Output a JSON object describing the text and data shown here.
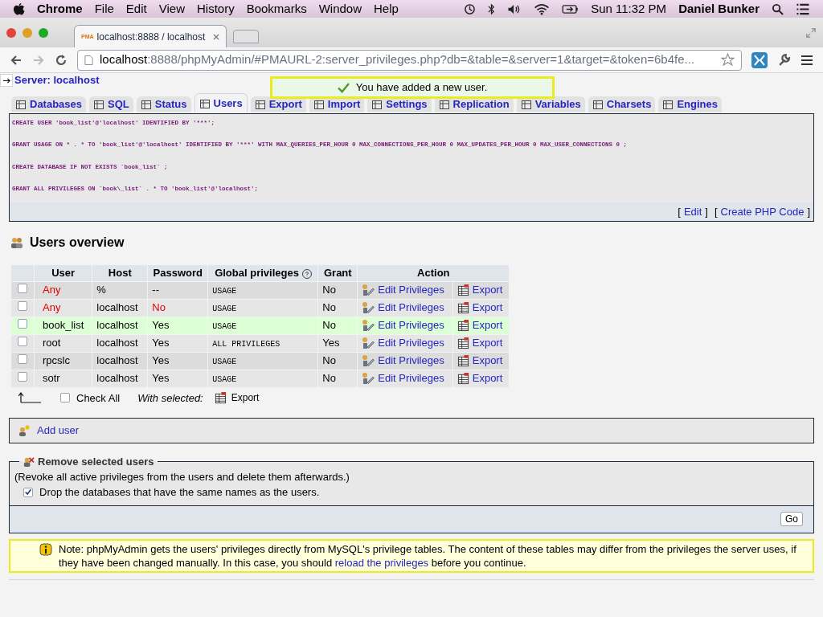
{
  "menubar": {
    "app": "Chrome",
    "menus": [
      "File",
      "Edit",
      "View",
      "History",
      "Bookmarks",
      "Window",
      "Help"
    ],
    "clock": "Sun 11:32 PM",
    "user": "Daniel Bunker"
  },
  "browser": {
    "tab_title": "localhost:8888 / localhost",
    "tab_badge": "PMA",
    "url_host": "localhost",
    "url_rest": ":8888/phpMyAdmin/#PMAURL-2:server_privileges.php?db=&table=&server=1&target=&token=6b4fe..."
  },
  "breadcrumb": "Server: localhost",
  "notification": "You have added a new user.",
  "tabs": [
    {
      "label": "Databases",
      "selected": false
    },
    {
      "label": "SQL",
      "selected": false
    },
    {
      "label": "Status",
      "selected": false
    },
    {
      "label": "Users",
      "selected": true
    },
    {
      "label": "Export",
      "selected": false
    },
    {
      "label": "Import",
      "selected": false
    },
    {
      "label": "Settings",
      "selected": false
    },
    {
      "label": "Replication",
      "selected": false
    },
    {
      "label": "Variables",
      "selected": false
    },
    {
      "label": "Charsets",
      "selected": false
    },
    {
      "label": "Engines",
      "selected": false
    }
  ],
  "sql_lines": [
    "CREATE USER 'book_list'@'localhost' IDENTIFIED BY '***';",
    "GRANT USAGE ON * . * TO 'book_list'@'localhost' IDENTIFIED BY '***' WITH MAX_QUERIES_PER_HOUR 0 MAX_CONNECTIONS_PER_HOUR 0 MAX_UPDATES_PER_HOUR 0 MAX_USER_CONNECTIONS 0 ;",
    "CREATE DATABASE IF NOT EXISTS `book_list` ;",
    "GRANT ALL PRIVILEGES ON `book\\_list` . * TO 'book_list'@'localhost';"
  ],
  "sql_links": [
    {
      "open": "[",
      "label": "Edit",
      "close": "]"
    },
    {
      "open": "[",
      "label": "Create PHP Code",
      "close": "]"
    }
  ],
  "users_overview": {
    "title": "Users overview",
    "columns": [
      "User",
      "Host",
      "Password",
      "Global privileges",
      "Grant",
      "Action"
    ],
    "rows": [
      {
        "user": "Any",
        "user_warn": true,
        "host": "%",
        "password": "--",
        "password_warn": false,
        "privileges": "USAGE",
        "grant": "No",
        "checked": false,
        "highlighted": false,
        "edit": "Edit Privileges",
        "export": "Export"
      },
      {
        "user": "Any",
        "user_warn": true,
        "host": "localhost",
        "password": "No",
        "password_warn": true,
        "privileges": "USAGE",
        "grant": "No",
        "checked": false,
        "highlighted": false,
        "edit": "Edit Privileges",
        "export": "Export"
      },
      {
        "user": "book_list",
        "user_warn": false,
        "host": "localhost",
        "password": "Yes",
        "password_warn": false,
        "privileges": "USAGE",
        "grant": "No",
        "checked": false,
        "highlighted": true,
        "edit": "Edit Privileges",
        "export": "Export"
      },
      {
        "user": "root",
        "user_warn": false,
        "host": "localhost",
        "password": "Yes",
        "password_warn": false,
        "privileges": "ALL PRIVILEGES",
        "grant": "Yes",
        "checked": false,
        "highlighted": false,
        "edit": "Edit Privileges",
        "export": "Export"
      },
      {
        "user": "rpcslc",
        "user_warn": false,
        "host": "localhost",
        "password": "Yes",
        "password_warn": false,
        "privileges": "USAGE",
        "grant": "No",
        "checked": false,
        "highlighted": false,
        "edit": "Edit Privileges",
        "export": "Export"
      },
      {
        "user": "sotr",
        "user_warn": false,
        "host": "localhost",
        "password": "Yes",
        "password_warn": false,
        "privileges": "USAGE",
        "grant": "No",
        "checked": false,
        "highlighted": false,
        "edit": "Edit Privileges",
        "export": "Export"
      }
    ],
    "check_all": {
      "label": "Check All",
      "checked": false
    },
    "with_selected": "With selected:",
    "bulk_export": "Export"
  },
  "add_user": "Add user",
  "remove": {
    "legend": "Remove selected users",
    "description": "(Revoke all active privileges from the users and delete them afterwards.)",
    "drop_label": "Drop the databases that have the same names as the users.",
    "drop_checked": true,
    "go": "Go"
  },
  "note": {
    "before": "Note: phpMyAdmin gets the users' privileges directly from MySQL's privilege tables. The content of these tables may differ from the privileges the server uses, if they have been changed manually. In this case, you should",
    "link": "reload the privileges",
    "after": "before you continue."
  }
}
